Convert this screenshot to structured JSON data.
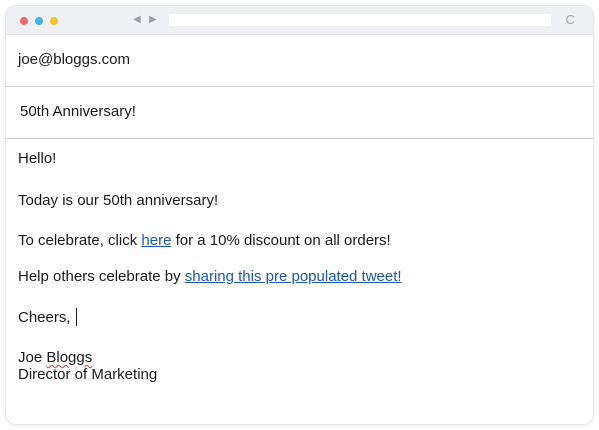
{
  "browser": {
    "back_icon": "back-arrow-icon",
    "forward_icon": "forward-arrow-icon",
    "reload_icon": "reload-icon",
    "reload_glyph": "C",
    "back_glyph": "◀",
    "forward_glyph": "▶"
  },
  "email": {
    "to": "joe@bloggs.com",
    "subject": "50th Anniversary!",
    "greeting": "Hello!",
    "line_anniversary": "Today is our 50th anniversary!",
    "celebrate_prefix": "To celebrate, click ",
    "celebrate_link": "here",
    "celebrate_suffix": " for a 10% discount on all orders!",
    "share_prefix": "Help others celebrate by ",
    "share_link": "sharing this pre populated tweet!",
    "signoff": "Cheers,",
    "signature_first": "Joe ",
    "signature_last": "Bloggs",
    "signature_title": "Director of Marketing"
  },
  "colors": {
    "link": "#1a57b8",
    "spellcheck": "#e23b3b",
    "dot_red": "#f06a6a",
    "dot_blue": "#3bb6e6",
    "dot_yellow": "#f3c332"
  }
}
